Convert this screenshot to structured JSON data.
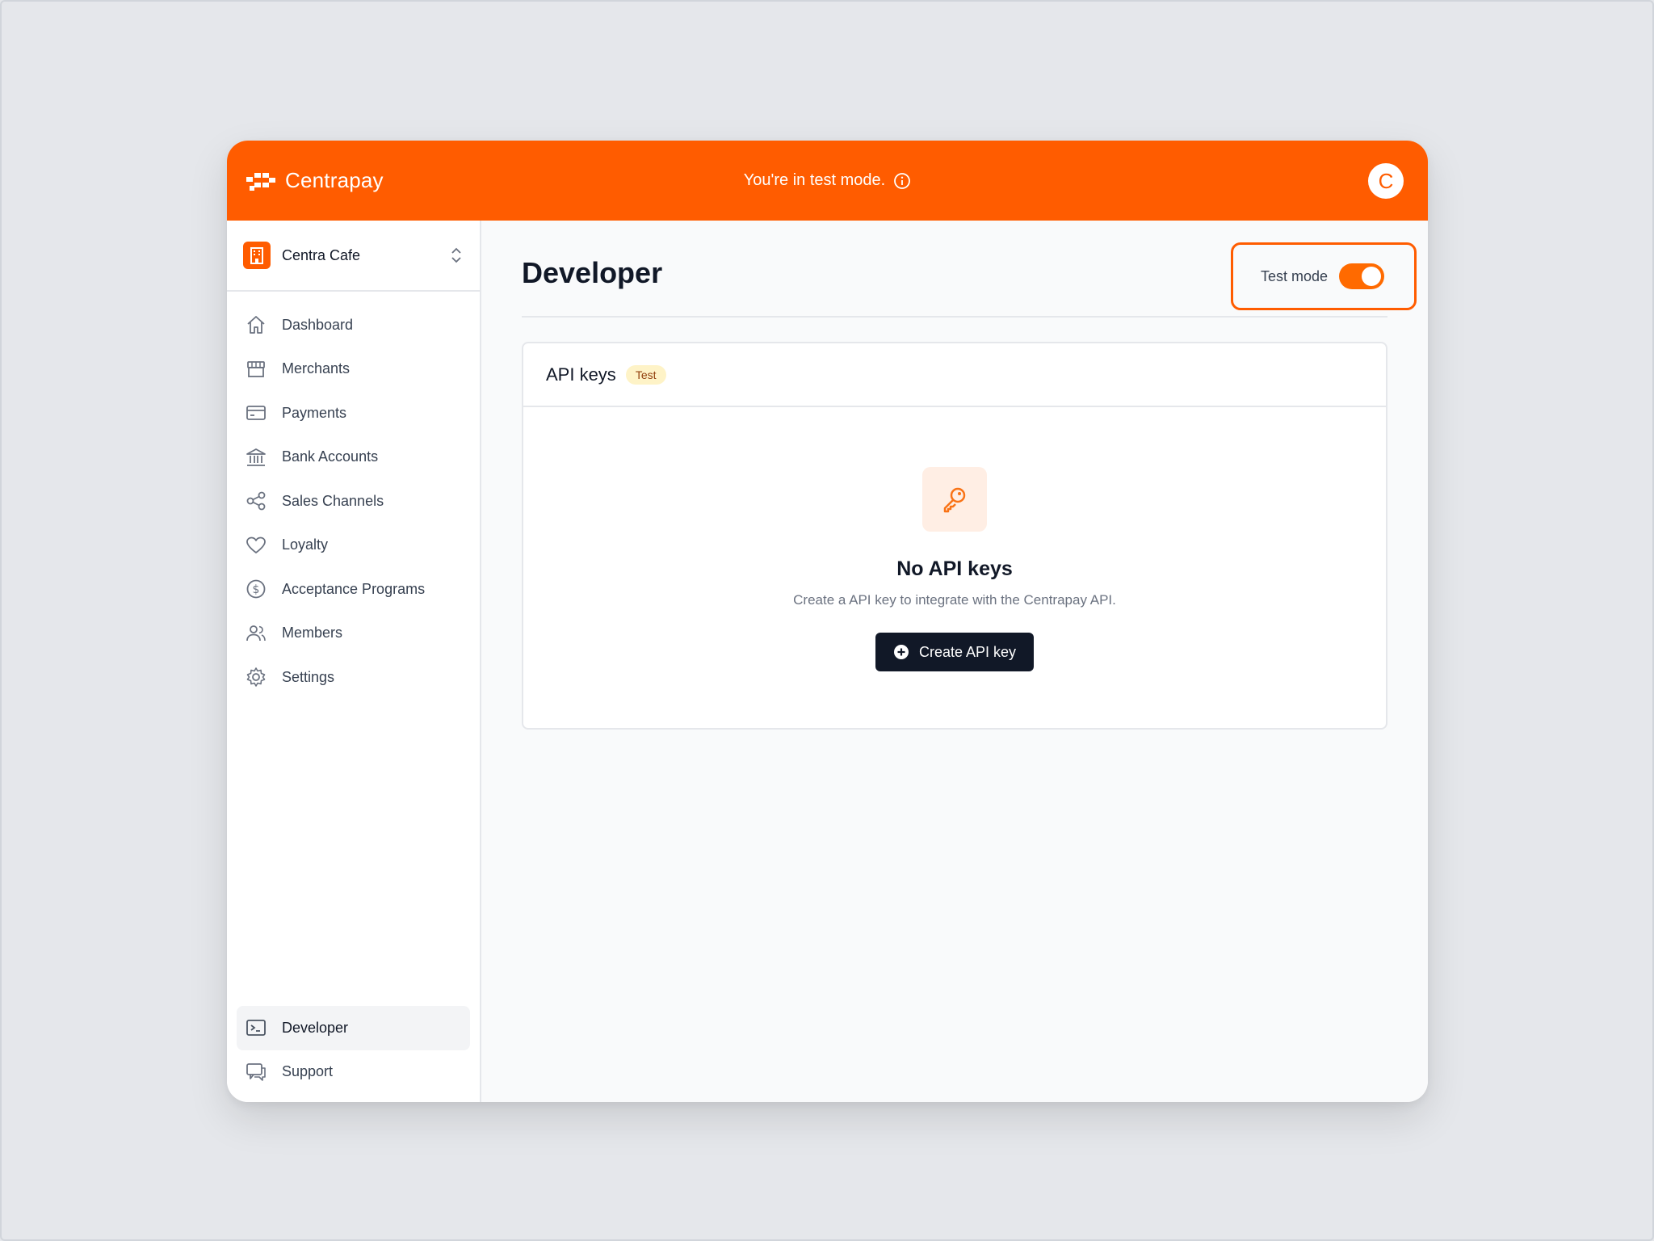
{
  "header": {
    "brand_name": "Centrapay",
    "test_banner": "You're in test mode.",
    "avatar_initial": "C",
    "color": "#ff5c00"
  },
  "sidebar": {
    "org_name": "Centra Cafe",
    "items": [
      {
        "label": "Dashboard",
        "icon": "home-icon"
      },
      {
        "label": "Merchants",
        "icon": "store-icon"
      },
      {
        "label": "Payments",
        "icon": "credit-card-icon"
      },
      {
        "label": "Bank Accounts",
        "icon": "bank-icon"
      },
      {
        "label": "Sales Channels",
        "icon": "share-icon"
      },
      {
        "label": "Loyalty",
        "icon": "heart-icon"
      },
      {
        "label": "Acceptance Programs",
        "icon": "dollar-circle-icon"
      },
      {
        "label": "Members",
        "icon": "users-icon"
      },
      {
        "label": "Settings",
        "icon": "gear-icon"
      }
    ],
    "bottom_items": [
      {
        "label": "Developer",
        "icon": "terminal-icon",
        "active": true
      },
      {
        "label": "Support",
        "icon": "chat-icon"
      }
    ]
  },
  "main": {
    "title": "Developer",
    "toggle_label": "Test mode",
    "toggle_on": true,
    "card": {
      "title": "API keys",
      "badge": "Test",
      "empty_title": "No API keys",
      "empty_subtitle": "Create a API key to integrate with the Centrapay API.",
      "create_button": "Create API key"
    }
  }
}
